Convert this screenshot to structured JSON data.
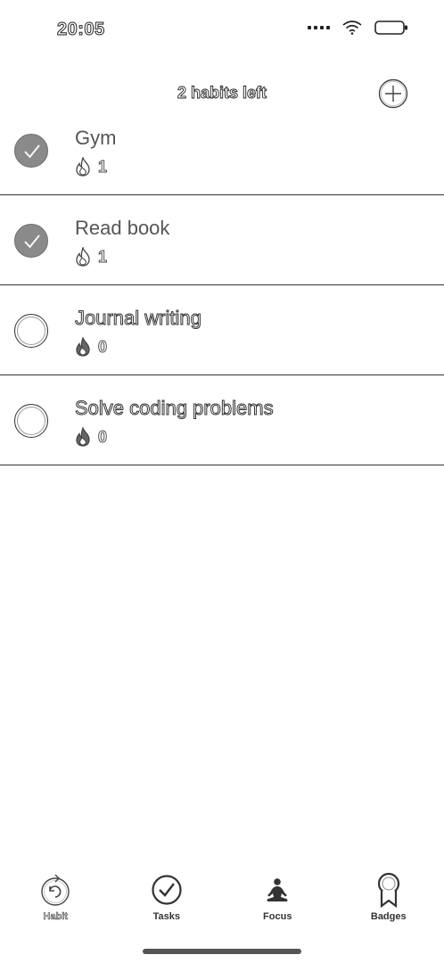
{
  "status_bar": {
    "time": "20:05",
    "icons": [
      "signal-icon",
      "wifi-icon",
      "battery-icon"
    ]
  },
  "header": {
    "habits_left": "2 habits left",
    "add_icon": "plus-circle-icon"
  },
  "habits": [
    {
      "name": "Gym",
      "streak": "1",
      "done": true
    },
    {
      "name": "Read book",
      "streak": "1",
      "done": true
    },
    {
      "name": "Journal writing",
      "streak": "0",
      "done": false
    },
    {
      "name": "Solve coding problems",
      "streak": "0",
      "done": false
    }
  ],
  "nav": {
    "items": [
      {
        "label": "Habit",
        "icon": "habit-refresh-icon",
        "active": false
      },
      {
        "label": "Tasks",
        "icon": "check-circle-icon",
        "active": true
      },
      {
        "label": "Focus",
        "icon": "meditation-icon",
        "active": true
      },
      {
        "label": "Badges",
        "icon": "award-ribbon-icon",
        "active": true
      }
    ]
  },
  "colors": {
    "done_fill": "#8a8a8a",
    "divider": "#333333",
    "text_dark": "#555555",
    "home_indicator": "#555555"
  }
}
